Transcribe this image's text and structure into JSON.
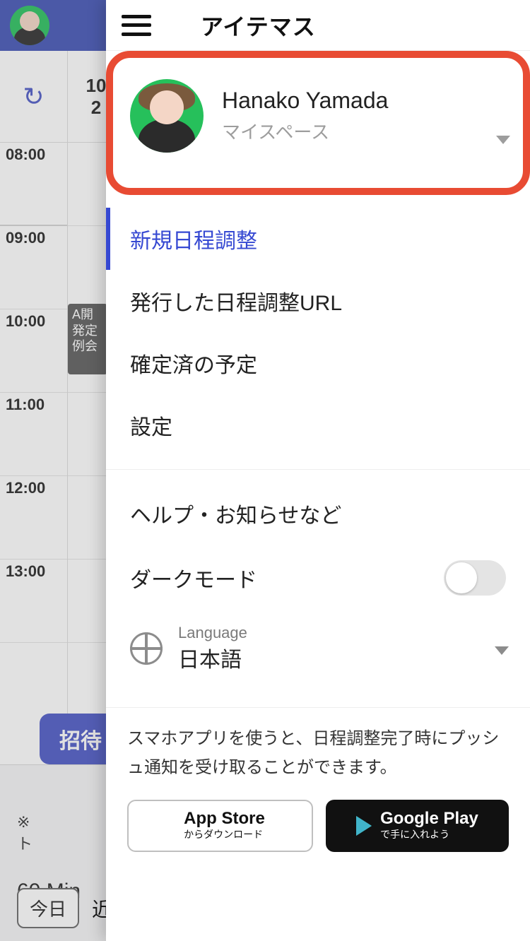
{
  "underlay": {
    "date_top": "10",
    "date_mid": "2",
    "times": [
      "08:00",
      "09:00",
      "10:00",
      "11:00",
      "12:00",
      "13:00"
    ],
    "event_text": "A開\n発定\n例会",
    "invite_label": "招待",
    "footer_asterisk": "※",
    "footer_trunc": "ト",
    "duration": "60 Min",
    "today_label": "今日",
    "footer_tail": "近"
  },
  "drawer": {
    "title": "アイテマス",
    "profile": {
      "name": "Hanako Yamada",
      "space": "マイスペース"
    },
    "menu": {
      "new_schedule": "新規日程調整",
      "issued_urls": "発行した日程調整URL",
      "confirmed": "確定済の予定",
      "settings": "設定"
    },
    "menu2": {
      "help": "ヘルプ・お知らせなど",
      "dark_mode": "ダークモード"
    },
    "language": {
      "label": "Language",
      "value": "日本語"
    },
    "promo": {
      "text": "スマホアプリを使うと、日程調整完了時にプッシュ通知を受け取ることができます。",
      "appstore_big": "App Store",
      "appstore_small": "からダウンロード",
      "google_big": "Google Play",
      "google_small": "で手に入れよう"
    }
  }
}
